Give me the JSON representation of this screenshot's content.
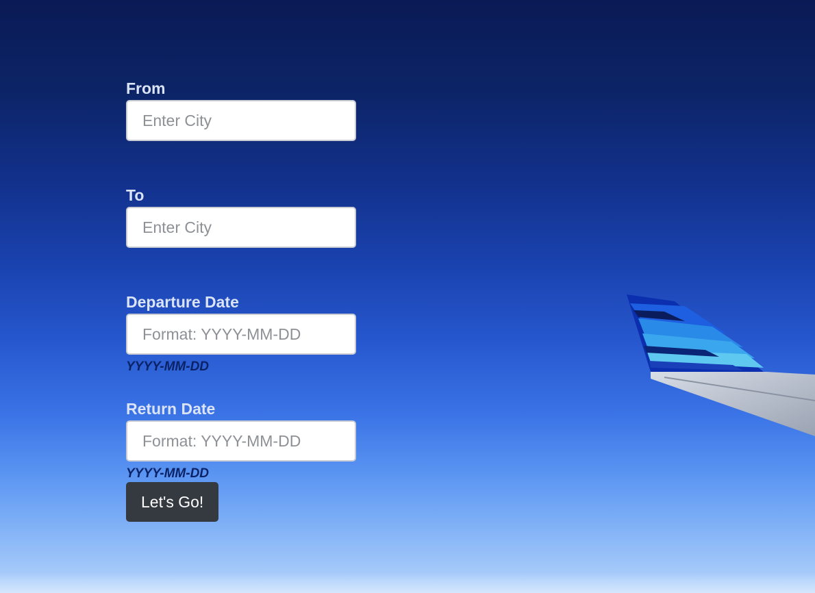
{
  "form": {
    "from": {
      "label": "From",
      "placeholder": "Enter City",
      "value": ""
    },
    "to": {
      "label": "To",
      "placeholder": "Enter City",
      "value": ""
    },
    "departure": {
      "label": "Departure Date",
      "placeholder": "Format: YYYY-MM-DD",
      "hint": "YYYY-MM-DD",
      "value": ""
    },
    "return": {
      "label": "Return Date",
      "placeholder": "Format: YYYY-MM-DD",
      "hint": "YYYY-MM-DD",
      "value": ""
    },
    "submit_label": "Let's Go!"
  },
  "colors": {
    "button_bg": "#343a40",
    "label_text": "#dbe4f7",
    "hint_text": "#0b2366",
    "wing_stripe_dark": "#0b3fd1",
    "wing_stripe_light": "#5ec8f0"
  },
  "background": {
    "scene": "airplane-wing-sky-image"
  }
}
